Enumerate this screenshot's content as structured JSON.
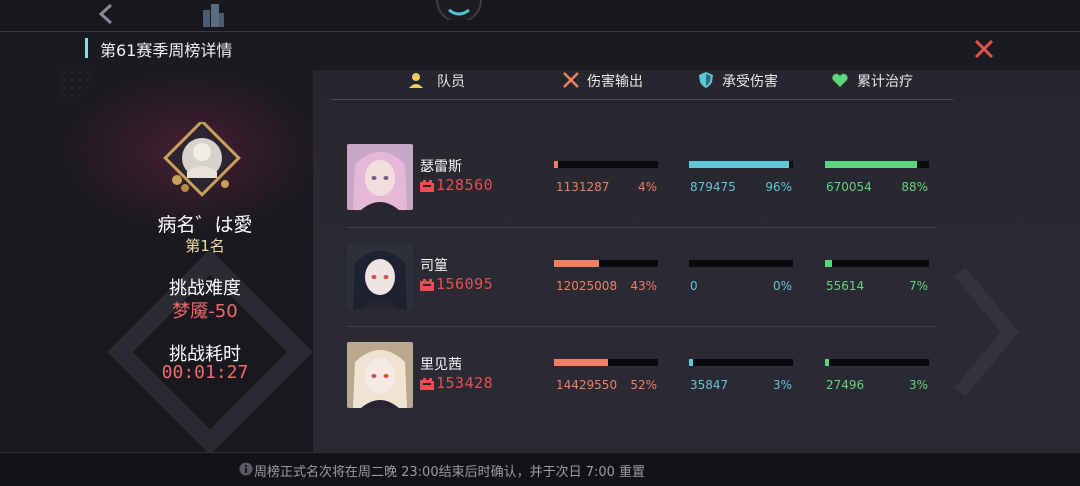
{
  "title": "第61赛季周榜详情",
  "left": {
    "name": "病名゛は愛",
    "rank": "第1名",
    "difficulty_label": "挑战难度",
    "difficulty_value": "梦魇-50",
    "time_label": "挑战耗时",
    "time_value": "00:01:27"
  },
  "header": {
    "member": "队员",
    "damage": "伤害输出",
    "taken": "承受伤害",
    "heal": "累计治疗"
  },
  "colors": {
    "damage": "#f07f63",
    "taken": "#5ec8d6",
    "heal": "#5cd67a",
    "power": "#e84f52"
  },
  "members": [
    {
      "name": "瑟雷斯",
      "power": "128560",
      "damage": "1131287",
      "damage_pct": "4%",
      "damage_ratio": 0.04,
      "taken": "879475",
      "taken_pct": "96%",
      "taken_ratio": 0.96,
      "heal": "670054",
      "heal_pct": "88%",
      "heal_ratio": 0.88
    },
    {
      "name": "司篁",
      "power": "156095",
      "damage": "12025008",
      "damage_pct": "43%",
      "damage_ratio": 0.43,
      "taken": "0",
      "taken_pct": "0%",
      "taken_ratio": 0.0,
      "heal": "55614",
      "heal_pct": "7%",
      "heal_ratio": 0.07
    },
    {
      "name": "里见茜",
      "power": "153428",
      "damage": "14429550",
      "damage_pct": "52%",
      "damage_ratio": 0.52,
      "taken": "35847",
      "taken_pct": "3%",
      "taken_ratio": 0.03,
      "heal": "27496",
      "heal_pct": "3%",
      "heal_ratio": 0.03
    }
  ],
  "footer": "周榜正式名次将在周二晚 23:00结束后时确认，并于次日 7:00 重置"
}
